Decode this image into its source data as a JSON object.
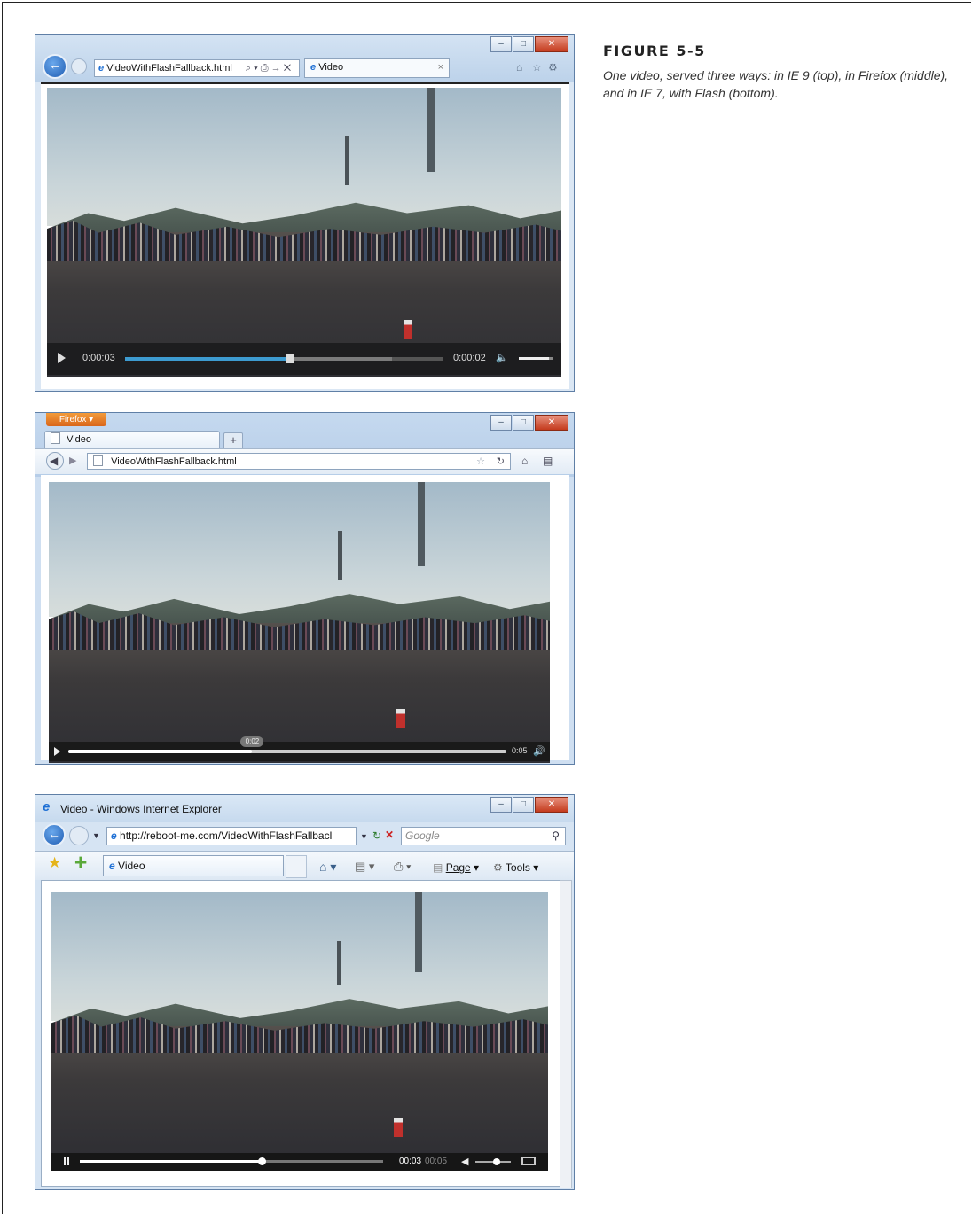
{
  "figure": {
    "label": "FIGURE 5-5",
    "caption": "One video, served three ways: in IE 9 (top), in Firefox (middle), and in IE 7, with Flash (bottom)."
  },
  "ie9": {
    "address": "VideoWithFlashFallback.html",
    "address_controls": "⌕ ▾ ⎙ → ✕",
    "tab_label": "Video",
    "tab_close": "×",
    "video": {
      "current_time": "0:00:03",
      "remaining_time": "0:00:02",
      "progress": 0.52,
      "buffered": 0.84,
      "volume": 0.9
    }
  },
  "firefox": {
    "menu_button": "Firefox ▾",
    "tab_label": "Video",
    "new_tab": "+",
    "address": "VideoWithFlashFallback.html",
    "video": {
      "tooltip_time": "0:02",
      "duration": "0:05",
      "progress": 0.42
    }
  },
  "ie7": {
    "window_title": "Video - Windows Internet Explorer",
    "address": "http://reboot-me.com/VideoWithFlashFallbacl",
    "search_placeholder": "Google",
    "tab_label": "Video",
    "page_menu": "Page",
    "tools_menu": "Tools",
    "video": {
      "current_time": "00:03",
      "duration": "00:05",
      "progress": 0.6,
      "volume": 0.6
    }
  },
  "icons": [
    "back-arrow-icon",
    "forward-arrow-icon",
    "ie-logo-icon",
    "home-icon",
    "star-icon",
    "gear-icon",
    "refresh-icon",
    "play-icon",
    "pause-icon",
    "volume-icon",
    "fullscreen-icon",
    "rss-icon",
    "print-icon",
    "search-icon"
  ]
}
